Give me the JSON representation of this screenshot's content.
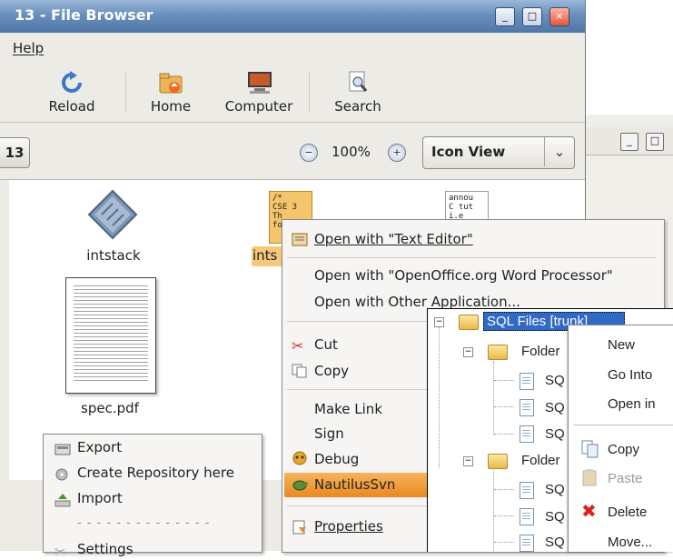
{
  "main_window": {
    "title": "13 - File Browser",
    "title_buttons": [
      "_",
      "□",
      "×"
    ],
    "menu": {
      "help": "Help"
    },
    "toolbar": [
      {
        "label": "Reload",
        "icon": "reload-icon"
      },
      {
        "label": "Home",
        "icon": "home-folder-icon"
      },
      {
        "label": "Computer",
        "icon": "computer-icon"
      },
      {
        "label": "Search",
        "icon": "search-icon"
      }
    ],
    "location": {
      "crumb": "13",
      "zoom": "100%",
      "view_mode": "Icon View"
    },
    "files": [
      {
        "name": "intstack",
        "icon": "diamond-executable-icon"
      },
      {
        "name": "ints",
        "preview": "/*\nCSE 3\nTh\nfo"
      },
      {
        "name": "",
        "preview": "annou\nC tut\ni.e"
      },
      {
        "name": "spec.pdf",
        "icon": "pdf-thumbnail-icon"
      }
    ]
  },
  "back_window": {
    "buttons": [
      "_",
      "□"
    ]
  },
  "context_menu": {
    "items": [
      {
        "label": "Open with \"Text Editor\"",
        "icon": "text-editor-icon"
      },
      {
        "label": "Open with \"OpenOffice.org Word Processor\""
      },
      {
        "label": "Open with Other Application..."
      },
      {
        "label": "Cut",
        "icon": "scissors-icon"
      },
      {
        "label": "Copy",
        "icon": "copy-icon"
      },
      {
        "label": "Make Link"
      },
      {
        "label": "Sign"
      },
      {
        "label": "Debug",
        "icon": "debug-icon"
      },
      {
        "label": "NautilusSvn",
        "icon": "svn-turtle-icon"
      },
      {
        "label": "Properties",
        "icon": "properties-icon"
      }
    ]
  },
  "svn_menu": {
    "items": [
      {
        "label": "Export",
        "icon": "export-icon"
      },
      {
        "label": "Create Repository here",
        "icon": "repository-icon"
      },
      {
        "label": "Import",
        "icon": "import-icon"
      },
      {
        "label": "- - - - - - - - - - - - - -"
      },
      {
        "label": "Settings",
        "icon": "settings-icon"
      }
    ]
  },
  "tree": {
    "root": "SQL Files [trunk]",
    "folder_label": "Folder",
    "file_label": "SQ"
  },
  "tree_menu": {
    "items": [
      {
        "label": "New"
      },
      {
        "label": "Go Into"
      },
      {
        "label": "Open in"
      },
      {
        "label": "Copy",
        "icon": "copy-icon"
      },
      {
        "label": "Paste",
        "icon": "paste-icon"
      },
      {
        "label": "Delete",
        "icon": "delete-icon"
      },
      {
        "label": "Move..."
      }
    ]
  },
  "colors": {
    "highlight": "#e8891f",
    "selection_blue": "#316ac5",
    "title_blue": "#5a7fb0"
  }
}
